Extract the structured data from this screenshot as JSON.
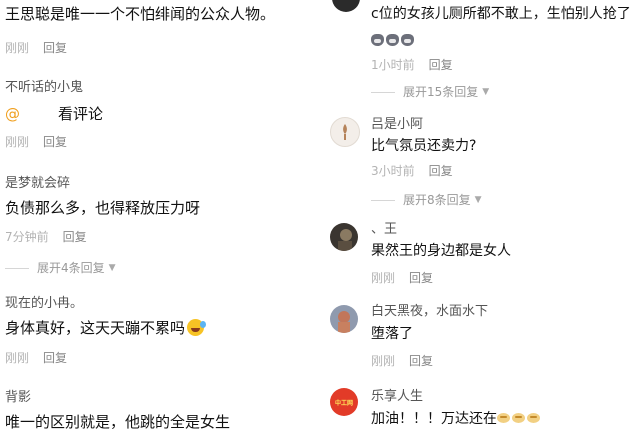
{
  "left_comments": [
    {
      "content": "王思聪是唯一一个不怕绯闻的公众人物。",
      "time": "刚刚",
      "reply": "回复"
    },
    {
      "username": "不听话的小鬼",
      "mention": "@",
      "content": "看评论",
      "time": "刚刚",
      "reply": "回复"
    },
    {
      "username": "是梦就会碎",
      "content": "负债那么多，也得释放压力呀",
      "time": "7分钟前",
      "reply": "回复",
      "expand": "展开4条回复"
    },
    {
      "username": "现在的小冉。",
      "content": "身体真好，这天天蹦不累吗",
      "time": "刚刚",
      "reply": "回复"
    },
    {
      "username": "背影",
      "content": "唯一的区别就是，他跳的全是女生"
    }
  ],
  "right_comments": [
    {
      "content": "c位的女孩儿厕所都不敢上，生怕别人抢了",
      "time": "1小时前",
      "reply": "回复",
      "expand": "展开15条回复"
    },
    {
      "username": "吕是小阿",
      "content": "比气氛员还卖力?",
      "time": "3小时前",
      "reply": "回复",
      "expand": "展开8条回复"
    },
    {
      "username": "、王",
      "content": "果然王的身边都是女人",
      "time": "刚刚",
      "reply": "回复"
    },
    {
      "username": "白天黑夜，水面水下",
      "content": "堕落了",
      "time": "刚刚",
      "reply": "回复"
    },
    {
      "username": "乐享人生",
      "content": "加油！！！万达还在",
      "avatar_text": "中工网"
    }
  ],
  "colors": {
    "accent_mention": "#f0a020",
    "meta": "#b3b3b3",
    "text": "#111111"
  }
}
